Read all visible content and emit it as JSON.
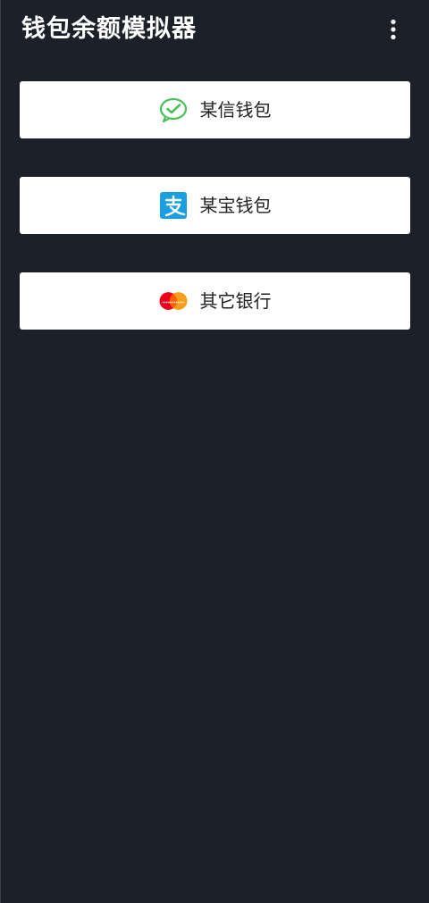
{
  "app_bar": {
    "title": "钱包余额模拟器",
    "more_icon": "more-vertical-icon"
  },
  "wallets": [
    {
      "label": "某信钱包",
      "icon": "wechat-icon",
      "color": "#4cc15b"
    },
    {
      "label": "某宝钱包",
      "icon": "alipay-icon",
      "color": "#1a9fe0"
    },
    {
      "label": "其它银行",
      "icon": "mastercard-icon",
      "color": "#eb001b"
    }
  ],
  "colors": {
    "background": "#1c2029",
    "card": "#ffffff",
    "text": "#222222"
  }
}
